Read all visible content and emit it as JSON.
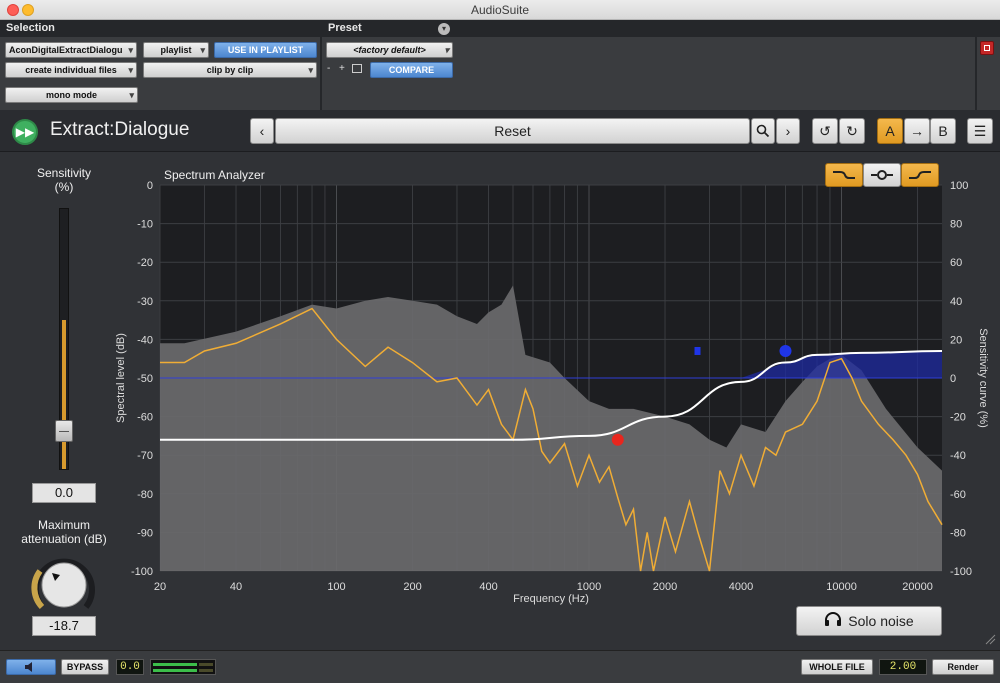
{
  "window": {
    "title": "AudioSuite"
  },
  "selection": {
    "header": "Selection",
    "plugin_select": "AconDigitalExtractDialogu",
    "playlist_select": "playlist",
    "use_in_playlist": "USE IN PLAYLIST",
    "create_files": "create individual files",
    "clip_by_clip": "clip by clip",
    "mono_mode": "mono mode"
  },
  "preset": {
    "header": "Preset",
    "current": "<factory default>",
    "compare": "COMPARE",
    "minus": "-",
    "plus": "+"
  },
  "plugin": {
    "name": "Extract:Dialogue",
    "preset_name": "Reset",
    "ab_a": "A",
    "ab_b": "B",
    "colors": {
      "accent": "#f0ad35",
      "brand_green": "#3fb060"
    }
  },
  "sensitivity": {
    "label_line1": "Sensitivity",
    "label_line2": "(%)",
    "value": "0.0",
    "slider_level": 0.57
  },
  "max_attenuation": {
    "label_line1": "Maximum",
    "label_line2": "attenuation (dB)",
    "value": "-18.7"
  },
  "analyzer": {
    "title": "Spectrum Analyzer",
    "left_label": "Spectral level (dB)",
    "right_label": "Sensitivity curve (%)",
    "x_label": "Frequency (Hz)",
    "curve_buttons": [
      "low-shelf-icon",
      "bell-icon",
      "high-shelf-icon"
    ]
  },
  "chart_data": {
    "type": "line",
    "xscale": "log",
    "xlim": [
      20,
      25000
    ],
    "ylim_left": [
      -100,
      0
    ],
    "ylim_right": [
      -100,
      100
    ],
    "x_ticks": [
      20,
      40,
      100,
      200,
      400,
      1000,
      2000,
      4000,
      10000,
      20000
    ],
    "y_left_ticks": [
      0,
      -10,
      -20,
      -30,
      -40,
      -50,
      -60,
      -70,
      -80,
      -90,
      -100
    ],
    "y_right_ticks": [
      100,
      80,
      60,
      40,
      20,
      0,
      -20,
      -40,
      -60,
      -80,
      -100
    ],
    "grid": true,
    "series": [
      {
        "role": "noise-spectrum",
        "color": "#6a6a6c",
        "x": [
          20,
          25,
          40,
          60,
          80,
          100,
          130,
          160,
          200,
          250,
          300,
          360,
          400,
          450,
          500,
          560,
          700,
          800,
          1000,
          1200,
          1500,
          2000,
          2500,
          3000,
          3500,
          4000,
          5000,
          6000,
          7000,
          8000,
          9000,
          10000,
          12000,
          15000,
          20000,
          25000
        ],
        "y": [
          -41,
          -41,
          -38,
          -34,
          -31,
          -32,
          -30,
          -29,
          -30,
          -31,
          -34,
          -36,
          -33,
          -31,
          -26,
          -44,
          -46,
          -50,
          -56,
          -58,
          -58,
          -60,
          -62,
          -66,
          -68,
          -62,
          -64,
          -56,
          -51,
          -47,
          -45,
          -44,
          -48,
          -58,
          -68,
          -74
        ]
      },
      {
        "role": "dialogue-spectrum",
        "color": "#f0ad35",
        "x": [
          20,
          25,
          30,
          40,
          60,
          80,
          100,
          130,
          160,
          200,
          250,
          300,
          360,
          400,
          450,
          500,
          560,
          600,
          650,
          700,
          800,
          900,
          1000,
          1100,
          1200,
          1300,
          1400,
          1500,
          1600,
          1700,
          1800,
          2000,
          2200,
          2500,
          2700,
          3000,
          3300,
          3600,
          4000,
          4500,
          5000,
          5500,
          6000,
          7000,
          8000,
          9000,
          10000,
          11000,
          12000,
          14000,
          16000,
          18000,
          20000,
          22000,
          25000
        ],
        "y": [
          -46,
          -46,
          -43,
          -41,
          -36,
          -32,
          -40,
          -47,
          -42,
          -46,
          -51,
          -50,
          -57,
          -53,
          -62,
          -66,
          -53,
          -58,
          -69,
          -72,
          -67,
          -78,
          -70,
          -77,
          -73,
          -81,
          -88,
          -84,
          -100,
          -90,
          -100,
          -86,
          -95,
          -82,
          -90,
          -100,
          -74,
          -80,
          -70,
          -78,
          -68,
          -70,
          -64,
          -62,
          -56,
          -46,
          -45,
          -50,
          -56,
          -62,
          -66,
          -70,
          -75,
          -82,
          -88
        ]
      },
      {
        "role": "sensitivity-curve",
        "color": "#ffffff",
        "x": [
          20,
          500,
          1000,
          2000,
          4000,
          6000,
          8000,
          12000,
          25000
        ],
        "y": [
          -66,
          -66,
          -65,
          -60,
          -51,
          -46,
          -44,
          -43.5,
          -43
        ]
      }
    ],
    "nodes": [
      {
        "color": "#e8261e",
        "x": 1300,
        "y": -66
      },
      {
        "color": "#1f35e8",
        "x": 6000,
        "y": -43
      }
    ],
    "threshold_db": -50
  },
  "solo": {
    "label": "Solo noise"
  },
  "footer": {
    "bypass": "BYPASS",
    "gain": "0.0",
    "whole_file": "WHOLE FILE",
    "handle": "2.00",
    "render": "Render"
  }
}
